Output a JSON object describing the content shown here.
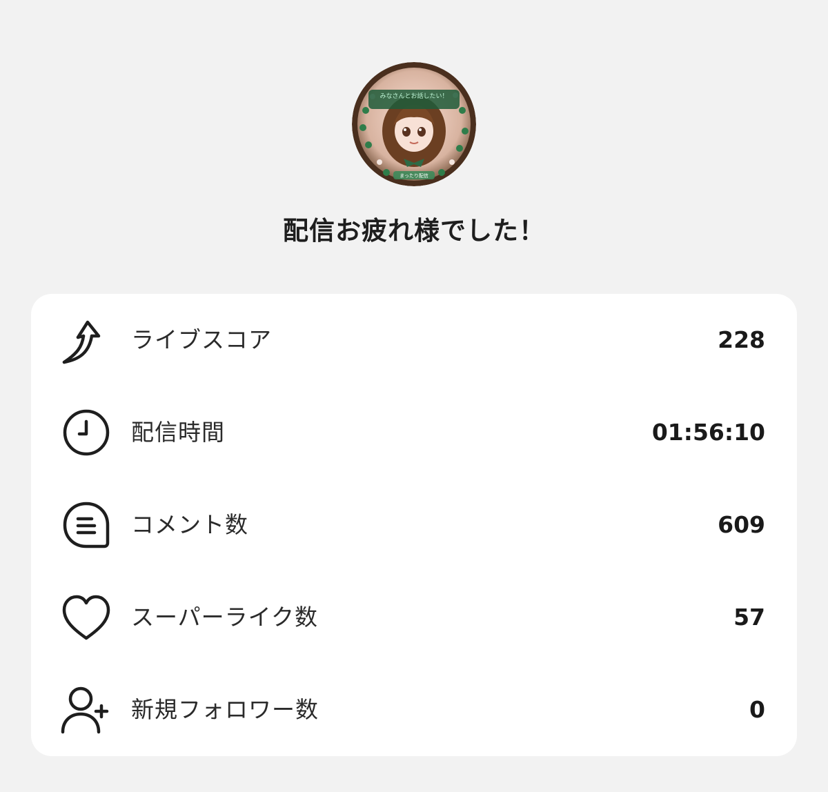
{
  "header": {
    "title": "配信お疲れ様でした！",
    "avatar": {
      "icon": "streamer-avatar",
      "banner_text": "みなさんとお話したい！",
      "footer_text": "まったり配信"
    }
  },
  "stats": [
    {
      "icon": "score-arrow-icon",
      "label": "ライブスコア",
      "value": "228"
    },
    {
      "icon": "clock-icon",
      "label": "配信時間",
      "value": "01:56:10"
    },
    {
      "icon": "comment-icon",
      "label": "コメント数",
      "value": "609"
    },
    {
      "icon": "heart-icon",
      "label": "スーパーライク数",
      "value": "57"
    },
    {
      "icon": "add-user-icon",
      "label": "新規フォロワー数",
      "value": "0"
    }
  ],
  "colors": {
    "background": "#f2f2f2",
    "card": "#ffffff",
    "text": "#1e1e1e",
    "icon_stroke": "#1e1e1e"
  }
}
